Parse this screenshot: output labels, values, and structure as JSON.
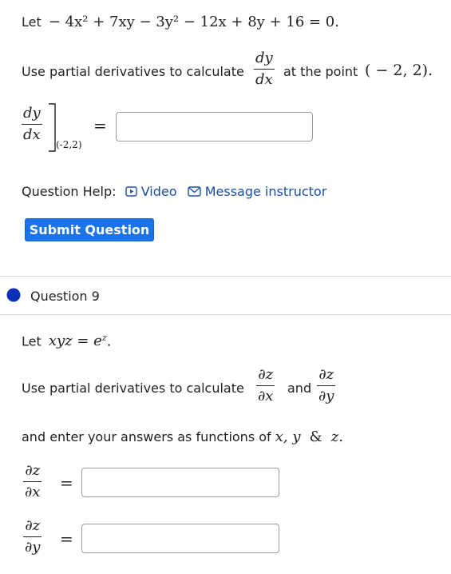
{
  "q8": {
    "let_word": "Let",
    "equation": "− 4x² + 7xy − 3y² − 12x + 8y + 16 = 0.",
    "instruction_pre": "Use partial derivatives to calculate",
    "deriv_num": "dy",
    "deriv_den": "dx",
    "instruction_post": "at the point",
    "point": "( − 2, 2).",
    "answer_label_num": "dy",
    "answer_label_den": "dx",
    "eval_subscript": "(-2,2)",
    "answer_value": "",
    "help_label": "Question Help:",
    "video_label": "Video",
    "message_label": "Message instructor",
    "submit_label": "Submit Question"
  },
  "q9": {
    "title": "Question 9",
    "let_word": "Let",
    "equation": "xyz = e",
    "equation_sup": "z",
    "equation_end": ".",
    "instruction_pre": "Use partial derivatives to calculate",
    "d1_num": "∂z",
    "d1_den": "∂x",
    "and_word": "and",
    "d2_num": "∂z",
    "d2_den": "∂y",
    "functions_text": "and enter your answers as functions of",
    "functions_vars": "x, y",
    "functions_amp": "&",
    "functions_z": "z.",
    "ans1_label_num": "∂z",
    "ans1_label_den": "∂x",
    "ans1_value": "",
    "ans2_label_num": "∂z",
    "ans2_label_den": "∂y",
    "ans2_value": ""
  },
  "colors": {
    "accent": "#1a73e8",
    "link": "#1a4fa3",
    "bullet": "#0a2fb8"
  }
}
